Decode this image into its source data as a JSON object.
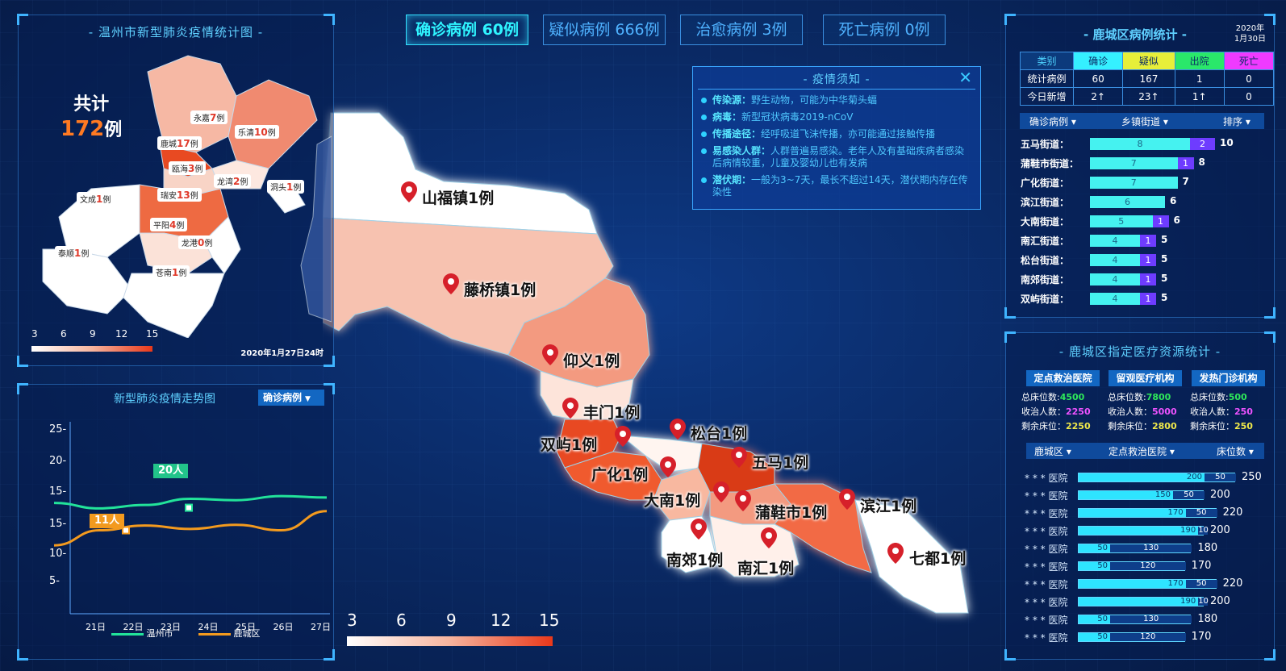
{
  "top_stats": [
    {
      "label": "确诊病例 60例",
      "active": true
    },
    {
      "label": "疑似病例 666例",
      "active": false
    },
    {
      "label": "治愈病例 3例",
      "active": false
    },
    {
      "label": "死亡病例 0例",
      "active": false
    }
  ],
  "left_map": {
    "title": "温州市新型肺炎疫情统计图",
    "total_label": "共计",
    "total_value": "172",
    "total_unit": "例",
    "regions": [
      {
        "name": "永嘉",
        "count": "7",
        "unit": "例"
      },
      {
        "name": "乐清",
        "count": "10",
        "unit": "例"
      },
      {
        "name": "鹿城",
        "count": "17",
        "unit": "例"
      },
      {
        "name": "瓯海",
        "count": "3",
        "unit": "例"
      },
      {
        "name": "龙湾",
        "count": "2",
        "unit": "例"
      },
      {
        "name": "洞头",
        "count": "1",
        "unit": "例"
      },
      {
        "name": "文成",
        "count": "1",
        "unit": "例"
      },
      {
        "name": "瑞安",
        "count": "13",
        "unit": "例"
      },
      {
        "name": "平阳",
        "count": "4",
        "unit": "例"
      },
      {
        "name": "龙港",
        "count": "0",
        "unit": "例"
      },
      {
        "name": "泰顺",
        "count": "1",
        "unit": "例"
      },
      {
        "name": "苍南",
        "count": "1",
        "unit": "例"
      }
    ],
    "legend_ticks": [
      "3",
      "6",
      "9",
      "12",
      "15"
    ],
    "timestamp": "2020年1月27日24时"
  },
  "trend": {
    "title": "新型肺炎疫情走势图",
    "dropdown": "确诊病例",
    "callout_a": "20人",
    "callout_b": "11人",
    "legend": [
      "温州市",
      "鹿城区"
    ],
    "colors": {
      "wenzhou": "#22e39a",
      "lucheng": "#f39a1e"
    }
  },
  "chart_data": {
    "type": "line",
    "x": [
      "21日",
      "22日",
      "23日",
      "24日",
      "25日",
      "26日",
      "27日"
    ],
    "y_ticks": [
      "25-",
      "20-",
      "15-",
      "15-",
      "10-",
      "5-"
    ],
    "ylim": [
      0,
      25
    ],
    "series": [
      {
        "name": "温州市",
        "values": [
          16.2,
          15.4,
          15.9,
          16.8,
          16.6,
          17.2,
          17.0
        ]
      },
      {
        "name": "鹿城区",
        "values": [
          10.0,
          12.2,
          12.9,
          12.4,
          13.0,
          12.2,
          15.0
        ]
      }
    ]
  },
  "main_map": {
    "pins": [
      {
        "label": "山福镇1例"
      },
      {
        "label": "藤桥镇1例"
      },
      {
        "label": "仰义1例"
      },
      {
        "label": "丰门1例"
      },
      {
        "label": "松台1例"
      },
      {
        "label": "双屿1例"
      },
      {
        "label": "五马1例"
      },
      {
        "label": "广化1例"
      },
      {
        "label": "大南1例"
      },
      {
        "label": "蒲鞋市1例"
      },
      {
        "label": "滨江1例"
      },
      {
        "label": "南郊1例"
      },
      {
        "label": "南汇1例"
      },
      {
        "label": "七都1例"
      }
    ],
    "legend_ticks": [
      "3",
      "6",
      "9",
      "12",
      "15"
    ]
  },
  "notice": {
    "title": "疫情须知",
    "items": [
      {
        "key": "传染源：",
        "text": "野生动物，可能为中华菊头蝠"
      },
      {
        "key": "病毒：",
        "text": "新型冠状病毒2019-nCoV"
      },
      {
        "key": "传播途径：",
        "text": "经呼吸道飞沫传播，亦可能通过接触传播"
      },
      {
        "key": "易感染人群：",
        "text": "人群普遍易感染。老年人及有基础疾病者感染后病情较重，儿童及婴幼儿也有发病"
      },
      {
        "key": "潜伏期：",
        "text": "一般为3~7天，最长不超过14天，潜伏期内存在传染性"
      }
    ]
  },
  "district_stats": {
    "title": "鹿城区病例统计",
    "date_year": "2020年",
    "date_day": "1月30日",
    "header": [
      "类别",
      "确诊",
      "疑似",
      "出院",
      "死亡"
    ],
    "rows": [
      {
        "label": "统计病例",
        "values": [
          "60",
          "167",
          "1",
          "0"
        ]
      },
      {
        "label": "今日新增",
        "values": [
          "2↑",
          "23↑",
          "1↑",
          "0"
        ]
      }
    ],
    "filters": [
      "确诊病例 ▾",
      "乡镇街道 ▾",
      "排序 ▾"
    ],
    "streets": [
      {
        "name": "五马街道：",
        "a": 8,
        "b": 2,
        "total": "10"
      },
      {
        "name": "蒲鞋市街道：",
        "a": 7,
        "b": 1,
        "total": "8"
      },
      {
        "name": "广化街道：",
        "a": 7,
        "b": 0,
        "total": "7"
      },
      {
        "name": "滨江街道：",
        "a": 6,
        "b": 0,
        "total": "6"
      },
      {
        "name": "大南街道：",
        "a": 5,
        "b": 1,
        "total": "6"
      },
      {
        "name": "南汇街道：",
        "a": 4,
        "b": 1,
        "total": "5"
      },
      {
        "name": "松台街道：",
        "a": 4,
        "b": 1,
        "total": "5"
      },
      {
        "name": "南郊街道：",
        "a": 4,
        "b": 1,
        "total": "5"
      },
      {
        "name": "双屿街道：",
        "a": 4,
        "b": 1,
        "total": "5"
      }
    ]
  },
  "medical": {
    "title": "鹿城区指定医疗资源统计",
    "columns": [
      {
        "head": "定点救治医院",
        "beds_label": "总床位数:",
        "beds": "4500",
        "admit_label": "收治人数：",
        "admit": "2250",
        "left_label": "剩余床位：",
        "left": "2250"
      },
      {
        "head": "留观医疗机构",
        "beds_label": "总床位数:",
        "beds": "7800",
        "admit_label": "收治人数：",
        "admit": "5000",
        "left_label": "剩余床位：",
        "left": "2800"
      },
      {
        "head": "发热门诊机构",
        "beds_label": "总床位数:",
        "beds": "500",
        "admit_label": "收治人数：",
        "admit": "250",
        "left_label": "剩余床位：",
        "left": "250"
      }
    ],
    "filters": [
      "鹿城区 ▾",
      "定点救治医院 ▾",
      "床位数 ▾"
    ],
    "hospitals": [
      {
        "name": "* * * 医院",
        "a": 200,
        "b": 50,
        "total": "250"
      },
      {
        "name": "* * * 医院",
        "a": 150,
        "b": 50,
        "total": "200"
      },
      {
        "name": "* * * 医院",
        "a": 170,
        "b": 50,
        "total": "220"
      },
      {
        "name": "* * * 医院",
        "a": 190,
        "b": 10,
        "total": "200"
      },
      {
        "name": "* * * 医院",
        "a": 50,
        "b": 130,
        "total": "180"
      },
      {
        "name": "* * * 医院",
        "a": 50,
        "b": 120,
        "total": "170"
      },
      {
        "name": "* * * 医院",
        "a": 170,
        "b": 50,
        "total": "220"
      },
      {
        "name": "* * * 医院",
        "a": 190,
        "b": 10,
        "total": "200"
      },
      {
        "name": "* * * 医院",
        "a": 50,
        "b": 130,
        "total": "180"
      },
      {
        "name": "* * * 医院",
        "a": 50,
        "b": 120,
        "total": "170"
      }
    ]
  }
}
